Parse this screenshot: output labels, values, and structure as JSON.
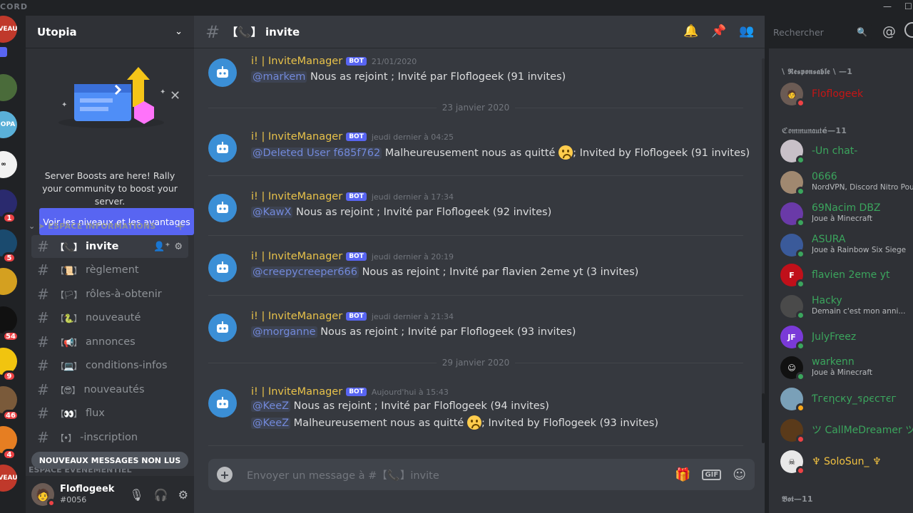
{
  "titlebar": {
    "brand": "CORD"
  },
  "guild_badges": [
    "VEAU",
    "OPA",
    "",
    "",
    "1",
    "5",
    "54",
    "9",
    "46",
    "4",
    "VEAU"
  ],
  "server": {
    "name": "Utopia",
    "boost_text": "Server Boosts are here! Rally your community to boost your server.",
    "boost_button": "Voir les niveaux et les avantages",
    "category": "ESPACE INFORMATIONS",
    "category2": "ESPACE ÉVÉNEMENTIEL",
    "new_messages": "NOUVEAUX MESSAGES NON LUS",
    "channels": [
      {
        "bracket_emoji": "【📞】",
        "name": "invite"
      },
      {
        "bracket_emoji": "【📜】",
        "name": "règlement"
      },
      {
        "bracket_emoji": "【🏳】",
        "name": "rôles-à-obtenir"
      },
      {
        "bracket_emoji": "【🐍】",
        "name": "nouveauté"
      },
      {
        "bracket_emoji": "【📢】",
        "name": "annonces"
      },
      {
        "bracket_emoji": "【💻】",
        "name": "conditions-infos"
      },
      {
        "bracket_emoji": "【😎】",
        "name": "nouveautés"
      },
      {
        "bracket_emoji": "【👀】",
        "name": "flux"
      },
      {
        "bracket_emoji": "【•】",
        "name": "-inscription"
      }
    ]
  },
  "user": {
    "name": "Floflogeek",
    "discriminator": "#0056"
  },
  "channel_header": {
    "emoji": "【📞】",
    "name": "invite"
  },
  "search_placeholder": "Rechercher",
  "messages": [
    {
      "author": "i! | InviteManager",
      "badge": "BOT",
      "time": "21/01/2020",
      "lines": [
        {
          "mention": "@markem",
          "text": "Nous as rejoint ; Invité par Floflogeek (91 invites)"
        }
      ]
    },
    {
      "author": "i! | InviteManager",
      "badge": "BOT",
      "time": "jeudi dernier à 04:25",
      "lines": [
        {
          "mention": "@Deleted User f685f762",
          "text": "Malheureusement nous as quitté",
          "text2": "; Invited by Floflogeek (91 invites)"
        }
      ]
    },
    {
      "author": "i! | InviteManager",
      "badge": "BOT",
      "time": "jeudi dernier à 17:34",
      "lines": [
        {
          "mention": "@KawX",
          "text": "Nous as rejoint ; Invité par Floflogeek (92 invites)"
        }
      ]
    },
    {
      "author": "i! | InviteManager",
      "badge": "BOT",
      "time": "jeudi dernier à 20:19",
      "lines": [
        {
          "mention": "@creepycreeper666",
          "text": "Nous as rejoint ; Invité par flavien 2eme yt (3 invites)"
        }
      ]
    },
    {
      "author": "i! | InviteManager",
      "badge": "BOT",
      "time": "jeudi dernier à 21:34",
      "lines": [
        {
          "mention": "@morganne",
          "text": "Nous as rejoint ; Invité par Floflogeek (93 invites)"
        }
      ]
    },
    {
      "author": "i! | InviteManager",
      "badge": "BOT",
      "time": "Aujourd'hui à 15:43",
      "lines": [
        {
          "mention": "@KeeZ",
          "text": "Nous as rejoint ; Invité par Floflogeek (94 invites)"
        },
        {
          "mention": "@KeeZ",
          "text": "Malheureusement nous as quitté",
          "text2": "; Invited by Floflogeek (93 invites)"
        }
      ]
    }
  ],
  "dividers": [
    "23 janvier 2020",
    "29 janvier 2020"
  ],
  "composer_placeholder": "Envoyer un message à #【📞】invite",
  "composer_gif": "GIF",
  "member_groups": [
    "\\ 𝕽𝖊𝖘𝖕𝖔𝖓𝖘𝖆𝖇𝖑𝖊 \\ —1",
    "ℭ𝔬𝔪𝔪𝔲𝔫𝔞𝔲𝔱é—11",
    "𝕭𝖔𝖙—11"
  ],
  "members": [
    {
      "name": "Floflogeek",
      "activity": "",
      "color": "#c61515",
      "status": "#ed4245"
    },
    {
      "name": "-Un chat-",
      "activity": "",
      "color": "#3ba55d",
      "status": "#3ba55d"
    },
    {
      "name": "0666",
      "activity": "NordVPN, Discord Nitro Pour...",
      "color": "#3ba55d",
      "status": "#3ba55d"
    },
    {
      "name": "69Nacim DBZ",
      "activity": "Joue à Minecraft",
      "color": "#3ba55d",
      "status": "#3ba55d"
    },
    {
      "name": "ASURA",
      "activity": "Joue à Rainbow Six Siege",
      "color": "#3ba55d",
      "status": "#3ba55d"
    },
    {
      "name": "flavien 2eme yt",
      "activity": "",
      "color": "#3ba55d",
      "status": "#3ba55d"
    },
    {
      "name": "Hacky",
      "activity": "Demain c'est mon anni...",
      "color": "#3ba55d",
      "status": "#3ba55d"
    },
    {
      "name": "JulyFreez",
      "activity": "",
      "color": "#3ba55d",
      "status": "#3ba55d"
    },
    {
      "name": "warkenn",
      "activity": "Joue à Minecraft",
      "color": "#3ba55d",
      "status": "#3ba55d"
    },
    {
      "name": "Ƭгєηcку_รρєcтєг",
      "activity": "",
      "color": "#3ba55d",
      "status": "#faa81a"
    },
    {
      "name": "ツ CallMeDreamer ツ",
      "activity": "",
      "color": "#3ba55d",
      "status": "#ed4245"
    },
    {
      "name": "♆ SoloSun_ ♆",
      "activity": "",
      "color": "#3ba55d",
      "status": "#ed4245"
    }
  ]
}
